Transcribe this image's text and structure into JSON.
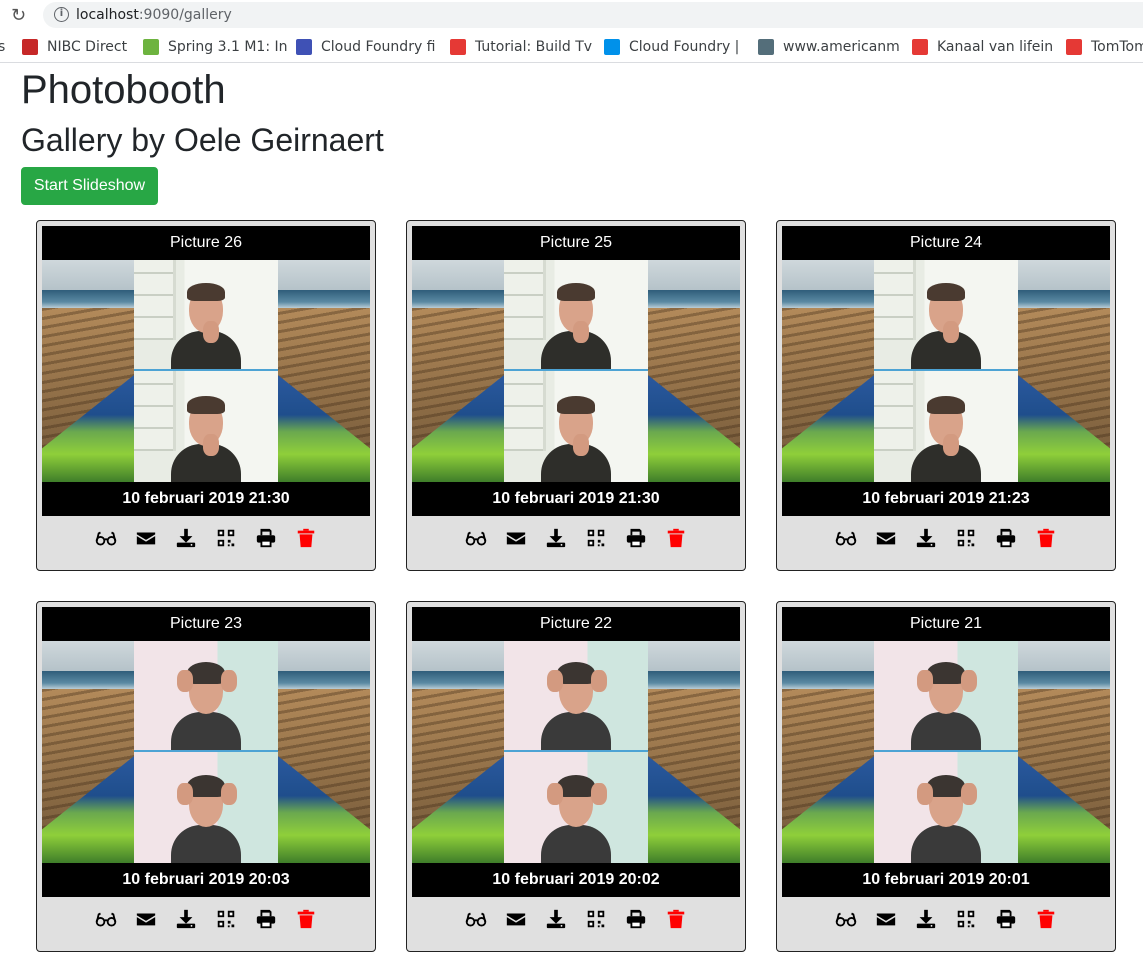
{
  "browser": {
    "url_host": "localhost",
    "url_path": ":9090/gallery",
    "bookmarks": [
      {
        "label": "s",
        "color": ""
      },
      {
        "label": "NIBC Direct",
        "color": "#c62828"
      },
      {
        "label": "Spring 3.1 M1: In",
        "color": "#6db33f"
      },
      {
        "label": "Cloud Foundry fi",
        "color": "#3f51b5"
      },
      {
        "label": "Tutorial: Build Tv",
        "color": "#e53935"
      },
      {
        "label": "Cloud Foundry |",
        "color": "#0091ea"
      },
      {
        "label": "www.americanm",
        "color": "#546e7a"
      },
      {
        "label": "Kanaal van lifein",
        "color": "#e53935"
      },
      {
        "label": "TomTom",
        "color": "#e53935"
      }
    ]
  },
  "page": {
    "title": "Photobooth",
    "subtitle": "Gallery by Oele Geirnaert",
    "slideshow_label": "Start Slideshow"
  },
  "cards": [
    {
      "title": "Picture 26",
      "date": "10 februari 2019 21:30",
      "scene": "light"
    },
    {
      "title": "Picture 25",
      "date": "10 februari 2019 21:30",
      "scene": "light"
    },
    {
      "title": "Picture 24",
      "date": "10 februari 2019 21:23",
      "scene": "light"
    },
    {
      "title": "Picture 23",
      "date": "10 februari 2019 20:03",
      "scene": "pink"
    },
    {
      "title": "Picture 22",
      "date": "10 februari 2019 20:02",
      "scene": "pink"
    },
    {
      "title": "Picture 21",
      "date": "10 februari 2019 20:01",
      "scene": "pink"
    }
  ],
  "actions": [
    "glasses-icon",
    "envelope-icon",
    "download-icon",
    "qrcode-icon",
    "print-icon",
    "trash-icon"
  ],
  "colors": {
    "accent": "#28a745",
    "delete": "#ff0000"
  }
}
